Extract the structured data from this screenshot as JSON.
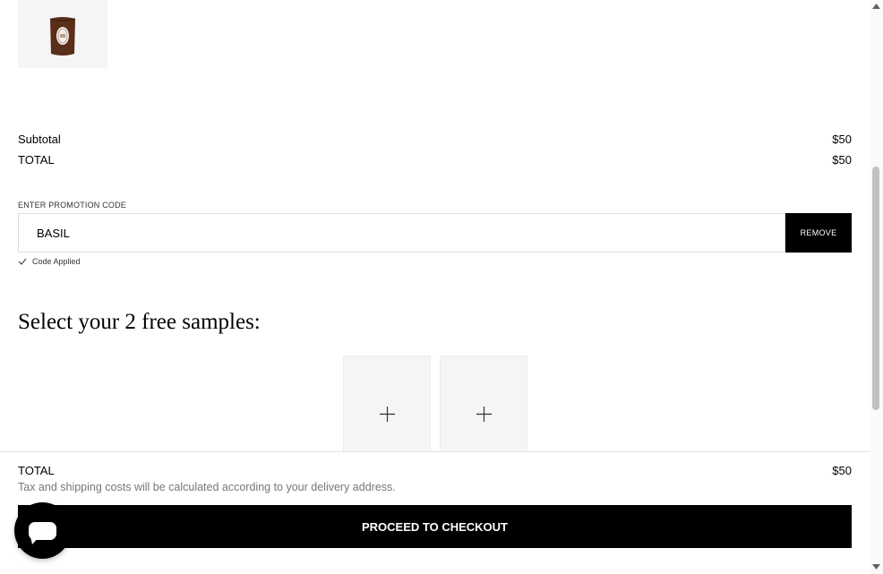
{
  "summary": {
    "subtotal_label": "Subtotal",
    "subtotal_value": "$50",
    "total_label": "TOTAL",
    "total_value": "$50"
  },
  "promo": {
    "label": "ENTER PROMOTION CODE",
    "value": "BASIL",
    "remove_label": "REMOVE",
    "status": "Code Applied"
  },
  "samples": {
    "title": "Select your 2 free samples:",
    "slots": 2
  },
  "footer": {
    "total_label": "TOTAL",
    "total_value": "$50",
    "note": "Tax and shipping costs will be calculated according to your delivery address.",
    "checkout_label": "PROCEED TO CHECKOUT"
  },
  "icons": {
    "product": "candle-product-image",
    "plus": "plus-icon",
    "check": "check-icon",
    "chat": "chat-icon"
  },
  "colors": {
    "button_bg": "#000000",
    "button_text": "#ffffff",
    "slot_bg": "#f5f5f5",
    "note_text": "#777777"
  }
}
